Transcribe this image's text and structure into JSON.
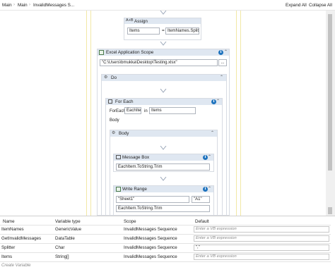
{
  "breadcrumb": [
    "Main",
    "Main",
    "InvalidMessages S..."
  ],
  "toolbar": {
    "expand_all": "Expand All",
    "collapse_all": "Collapse All"
  },
  "assign": {
    "title": "Assign",
    "left": "Items",
    "op": "=",
    "right": "ItemNames.Split(\",\")"
  },
  "excel_scope": {
    "title": "Excel Application Scope",
    "path": "\"C:\\Users\\bmukka\\Desktop\\Testing.xlsx\"",
    "browse": "..."
  },
  "do": {
    "title": "Do"
  },
  "for_each": {
    "title": "For Each",
    "for_each_label": "ForEach",
    "item": "EachItem",
    "in_label": "in",
    "collection": "Items",
    "body_label": "Body"
  },
  "body": {
    "title": "Body"
  },
  "message_box": {
    "title": "Message Box",
    "text": "EachItem.ToString.Trim"
  },
  "write_range": {
    "title": "Write Range",
    "sheet": "\"Sheet1\"",
    "cell": "\"A1\"",
    "value": "EachItem.ToString.Trim"
  },
  "variables": {
    "headers": [
      "Name",
      "Variable type",
      "Scope",
      "Default"
    ],
    "rows": [
      {
        "name": "ItemNames",
        "type": "GenericValue",
        "scope": "InvalidMessages Sequence",
        "default": "Enter a VB expression"
      },
      {
        "name": "GetInvalidMessages",
        "type": "DataTable",
        "scope": "InvalidMessages Sequence",
        "default": "Enter a VB expression"
      },
      {
        "name": "Splitter",
        "type": "Char",
        "scope": "InvalidMessages Sequence",
        "default": "\",\""
      },
      {
        "name": "Items",
        "type": "String[]",
        "scope": "InvalidMessages Sequence",
        "default": "Enter a VB expression"
      }
    ],
    "create_label": "Create Variable"
  },
  "colors": {
    "header_bg": "#dfe7f1",
    "accent": "#1e73be",
    "yellow_line": "#f2e8a6"
  }
}
